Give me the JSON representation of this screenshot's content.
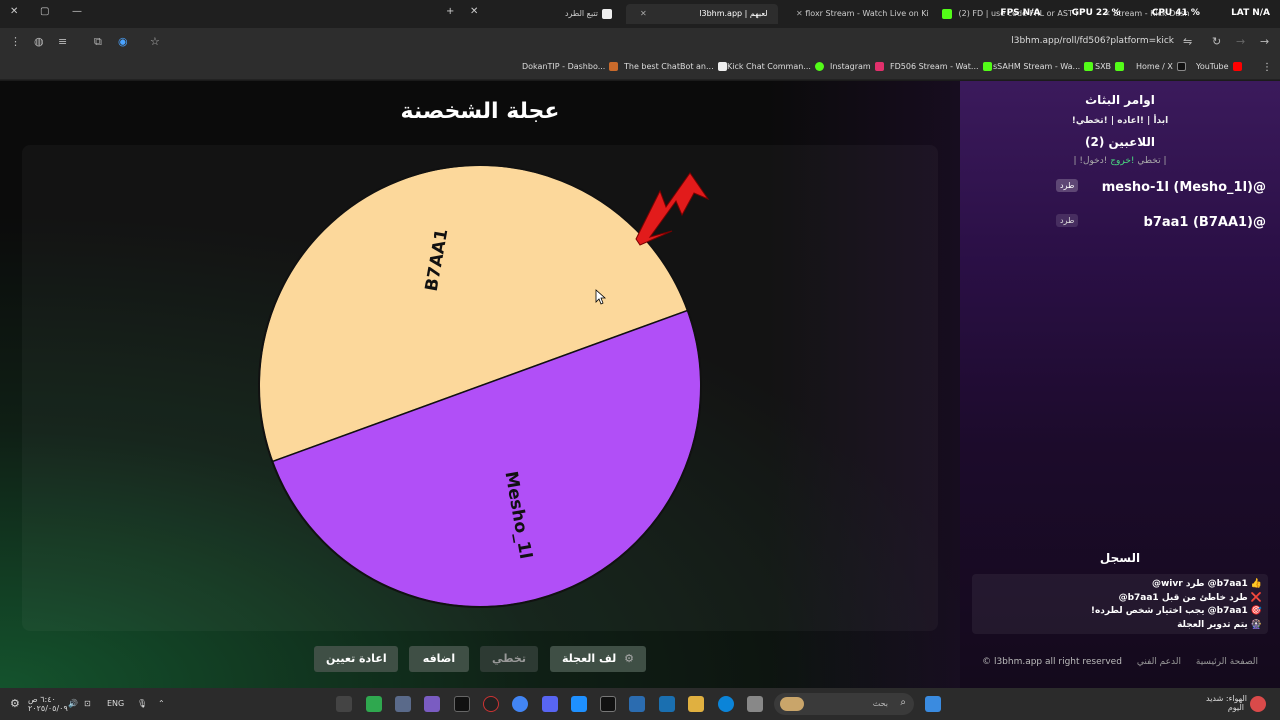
{
  "browser": {
    "tabs": [
      {
        "label": "تتبع الطرد"
      },
      {
        "label": "l3bhm.app | لعبهم",
        "active": true
      },
      {
        "label": "floxr Stream - Watch Live on Ki"
      },
      {
        "label": "(2) FD | use code FRL or AST i"
      },
      {
        "label": "Stream - Kick Dashboard"
      }
    ],
    "perf": {
      "fps_label": "FPS",
      "fps_value": "N/A",
      "gpu_label": "GPU",
      "gpu_value": "22 %",
      "cpu_label": "CPU",
      "cpu_value": "41 %",
      "lat_label": "LAT",
      "lat_value": "N/A"
    },
    "url": "l3bhm.app/roll/fd506?platform=kick",
    "bookmarks": [
      {
        "label": "DokanTIP - Dashbo..."
      },
      {
        "label": "The best ChatBot an..."
      },
      {
        "label": "Kick Chat Comman..."
      },
      {
        "label": "Instagram"
      },
      {
        "label": "FD506 Stream - Wat..."
      },
      {
        "label": "sSAHM Stream - Wa..."
      },
      {
        "label": "SXB"
      },
      {
        "label": "Home / X"
      },
      {
        "label": "YouTube"
      }
    ]
  },
  "page": {
    "title": "عجلة الشخصنة",
    "wheel": {
      "segments": [
        {
          "label": "B7AA1",
          "color": "#fcd89b"
        },
        {
          "label": "Mesho_1l",
          "color": "#b14ff7"
        }
      ],
      "pointer_color": "#e21b1b"
    },
    "buttons": {
      "reset": "اعادة تعيين",
      "add": "اضافه",
      "skip": "تخطي",
      "spin": "لف العجلة",
      "spin_icon": "⚙"
    }
  },
  "sidebar": {
    "commands_title": "اوامر البثاث",
    "commands_line": "!ابدأ | !اعاده | !تخطي",
    "players_title": "اللاعبين (2)",
    "players_line_a": "!دخول |",
    "players_line_b": "!خروج",
    "players_line_c": "| !تخطي",
    "players": [
      {
        "name": "mesho-1l (Mesho_1l)@",
        "kick": "طرد"
      },
      {
        "name": "b7aa1 (B7AA1)@",
        "kick": "طرد"
      }
    ],
    "log_title": "السجل",
    "log": [
      {
        "icon": "👍",
        "text": "b7aa1@ طرد wivr@"
      },
      {
        "icon": "❌",
        "text": "طرد خاطئ من قبل b7aa1@"
      },
      {
        "icon": "🎯",
        "text": "b7aa1@ يجب اختيار شخص لطرده!"
      },
      {
        "icon": "🎡",
        "text": "يتم تدوير العجلة"
      }
    ],
    "footer": {
      "home": "الصفحة الرئيسية",
      "support": "الدعم الفني",
      "copyright": "l3bhm.app all right reserved ©"
    }
  },
  "taskbar": {
    "time": "٦:٤٠ ص",
    "date": "٢٠٢٥/٠٥/٠٩",
    "lang": "ENG",
    "search_placeholder": "بحث",
    "weather_line1": "الهواء: شديد",
    "weather_line2": "اليوم"
  }
}
